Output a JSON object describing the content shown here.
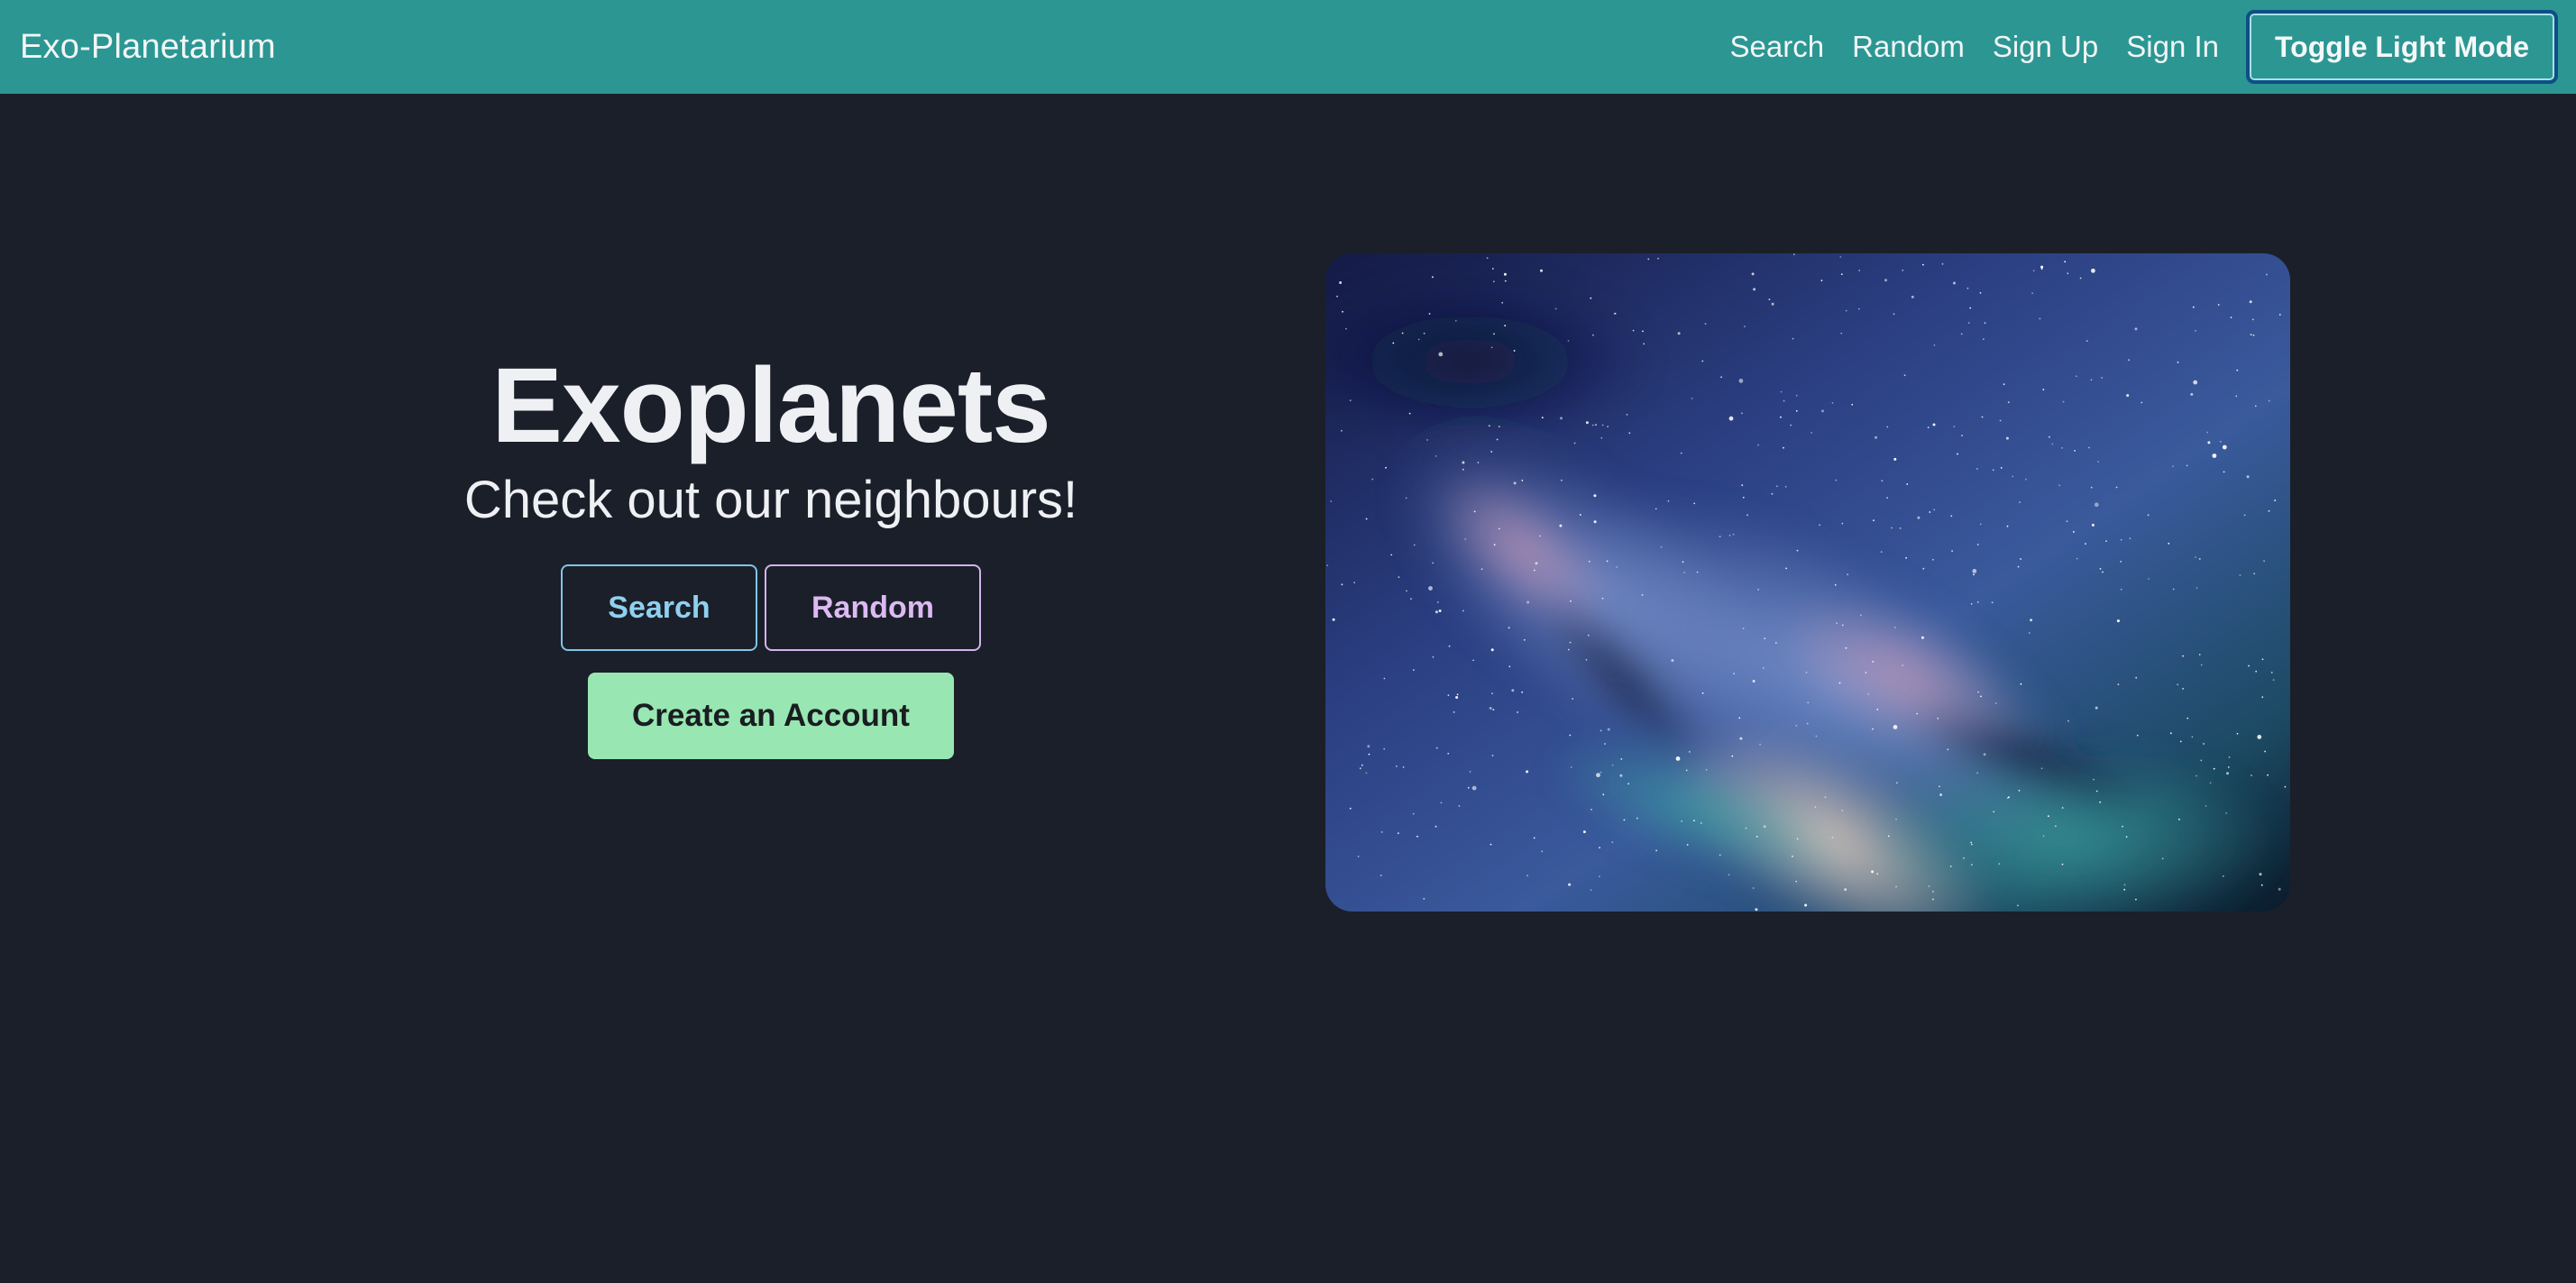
{
  "navbar": {
    "brand": "Exo-Planetarium",
    "links": [
      "Search",
      "Random",
      "Sign Up",
      "Sign In"
    ],
    "toggle_label": "Toggle Light Mode"
  },
  "hero": {
    "title": "Exoplanets",
    "subtitle": "Check out our neighbours!",
    "search_label": "Search",
    "random_label": "Random",
    "create_label": "Create an Account"
  },
  "colors": {
    "navbar_bg": "#2c9693",
    "page_bg": "#1b1f29",
    "search_outline": "#7fc6e8",
    "random_outline": "#d4b3ec",
    "create_bg": "#98e7b2"
  },
  "image": {
    "subject": "milky-way-starfield"
  }
}
